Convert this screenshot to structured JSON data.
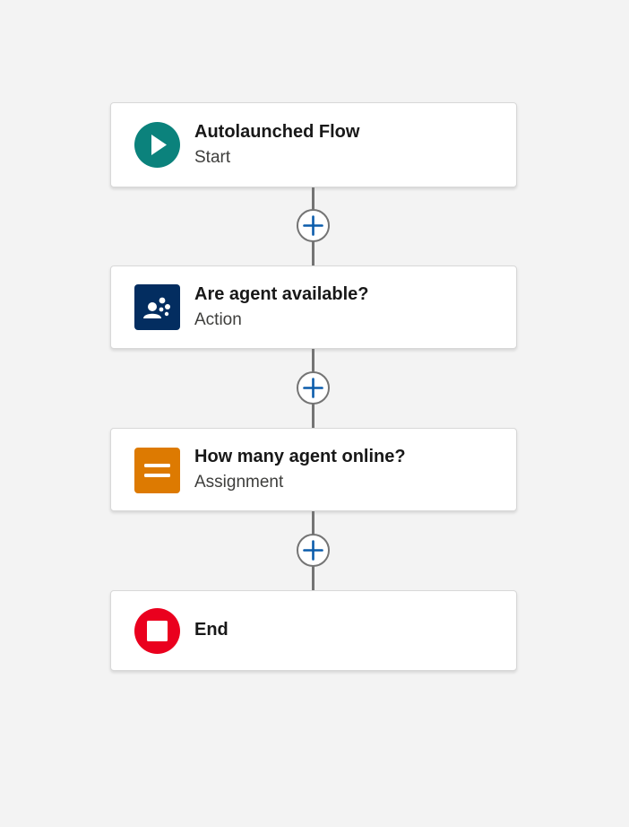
{
  "nodes": [
    {
      "title": "Autolaunched Flow",
      "subtitle": "Start",
      "icon": "play-icon",
      "color": "#0b827c"
    },
    {
      "title": "Are agent available?",
      "subtitle": "Action",
      "icon": "agent-action-icon",
      "color": "#032d60"
    },
    {
      "title": "How many agent online?",
      "subtitle": "Assignment",
      "icon": "assignment-equals-icon",
      "color": "#dd7a01"
    },
    {
      "title": "End",
      "subtitle": "",
      "icon": "stop-icon",
      "color": "#ea001e"
    }
  ],
  "add_button": {
    "icon": "plus-icon",
    "color": "#0b5cab"
  },
  "colors": {
    "canvas": "#f3f3f3",
    "connector": "#747474"
  }
}
